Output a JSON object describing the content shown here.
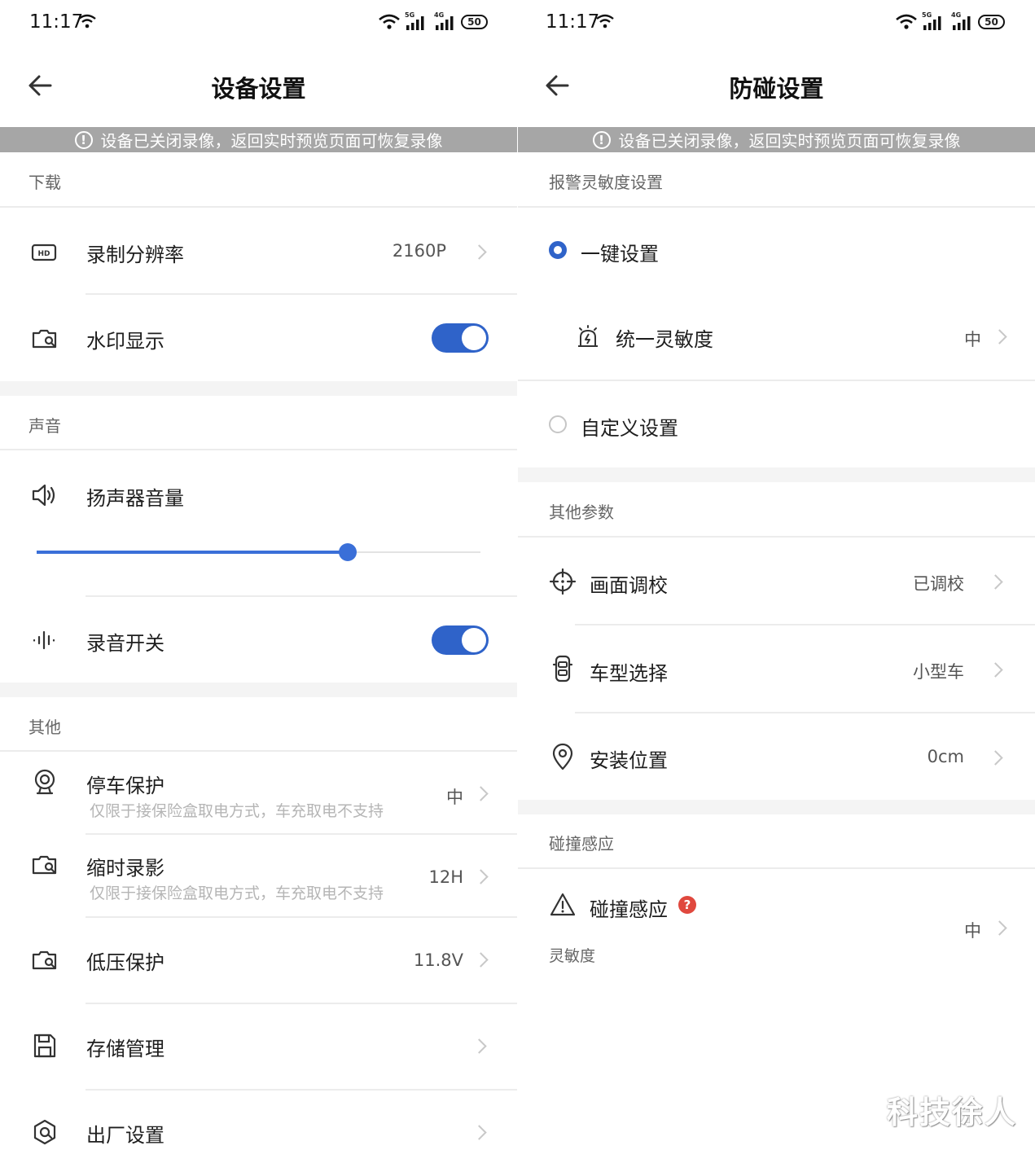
{
  "left": {
    "status": {
      "time": "11:17",
      "battery": "50",
      "net1": "5G",
      "net2": "4G"
    },
    "title": "设备设置",
    "banner": "设备已关闭录像，返回实时预览页面可恢复录像",
    "sections": {
      "download": "下载",
      "sound": "声音",
      "other": "其他"
    },
    "items": {
      "resolution": {
        "label": "录制分辨率",
        "value": "2160P",
        "icon": "hd-icon"
      },
      "watermark": {
        "label": "水印显示",
        "enabled": true,
        "icon": "camera-icon"
      },
      "speaker": {
        "label": "扬声器音量",
        "level": 0.7,
        "icon": "speaker-icon"
      },
      "recording": {
        "label": "录音开关",
        "enabled": true,
        "icon": "sound-wave-icon"
      },
      "parking": {
        "label": "停车保护",
        "sub": "仅限于接保险盒取电方式，车充取电不支持",
        "value": "中",
        "icon": "webcam-icon"
      },
      "timelapse": {
        "label": "缩时录影",
        "sub": "仅限于接保险盒取电方式，车充取电不支持",
        "value": "12H",
        "icon": "camera-icon"
      },
      "lowvolt": {
        "label": "低压保护",
        "value": "11.8V",
        "icon": "camera-icon"
      },
      "storage": {
        "label": "存储管理",
        "icon": "floppy-icon"
      },
      "factory": {
        "label": "出厂设置",
        "icon": "reset-icon"
      }
    }
  },
  "right": {
    "status": {
      "time": "11:17",
      "battery": "50",
      "net1": "5G",
      "net2": "4G"
    },
    "title": "防碰设置",
    "banner": "设备已关闭录像，返回实时预览页面可恢复录像",
    "sections": {
      "alarm": "报警灵敏度设置",
      "params": "其他参数",
      "collision": "碰撞感应"
    },
    "items": {
      "onekey": {
        "label": "一键设置",
        "selected": true
      },
      "unified": {
        "label": "统一灵敏度",
        "value": "中",
        "icon": "alarm-icon"
      },
      "custom": {
        "label": "自定义设置",
        "selected": false
      },
      "calibration": {
        "label": "画面调校",
        "value": "已调校",
        "icon": "crosshair-icon"
      },
      "cartype": {
        "label": "车型选择",
        "value": "小型车",
        "icon": "car-icon"
      },
      "position": {
        "label": "安装位置",
        "value": "0cm",
        "icon": "location-pin-icon"
      },
      "collision": {
        "label": "碰撞感应",
        "sub": "灵敏度",
        "value": "中",
        "help": "?",
        "icon": "warning-icon"
      }
    }
  },
  "watermark_text": "科技徐人",
  "colors": {
    "accent": "#2f63c9",
    "banner": "#a6a6a6",
    "help": "#e0483e"
  }
}
